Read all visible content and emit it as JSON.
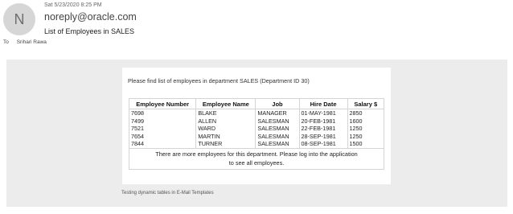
{
  "message": {
    "avatar_letter": "N",
    "date": "Sat 5/23/2020 8:25 PM",
    "from": "noreply@oracle.com",
    "subject": "List of Employees in SALES",
    "to_label": "To",
    "to_value": "Srihari Rawa"
  },
  "body": {
    "intro": "Please find list of employees in department SALES (Department ID 30)",
    "table": {
      "headers": [
        "Employee Number",
        "Employee Name",
        "Job",
        "Hire Date",
        "Salary $"
      ],
      "rows": [
        [
          "7698",
          "BLAKE",
          "MANAGER",
          "01-MAY-1981",
          "2850"
        ],
        [
          "7499",
          "ALLEN",
          "SALESMAN",
          "20-FEB-1981",
          "1600"
        ],
        [
          "7521",
          "WARD",
          "SALESMAN",
          "22-FEB-1981",
          "1250"
        ],
        [
          "7654",
          "MARTIN",
          "SALESMAN",
          "28-SEP-1981",
          "1250"
        ],
        [
          "7844",
          "TURNER",
          "SALESMAN",
          "08-SEP-1981",
          "1500"
        ]
      ],
      "note": "There are more employees for this department. Please log into the application to see all employees."
    },
    "footer": "Testing dynamic tables in E-Mail Templates"
  },
  "colors": {
    "panel_background": "#ececec",
    "card_background": "#ffffff",
    "avatar_background": "#d6d6d6"
  }
}
